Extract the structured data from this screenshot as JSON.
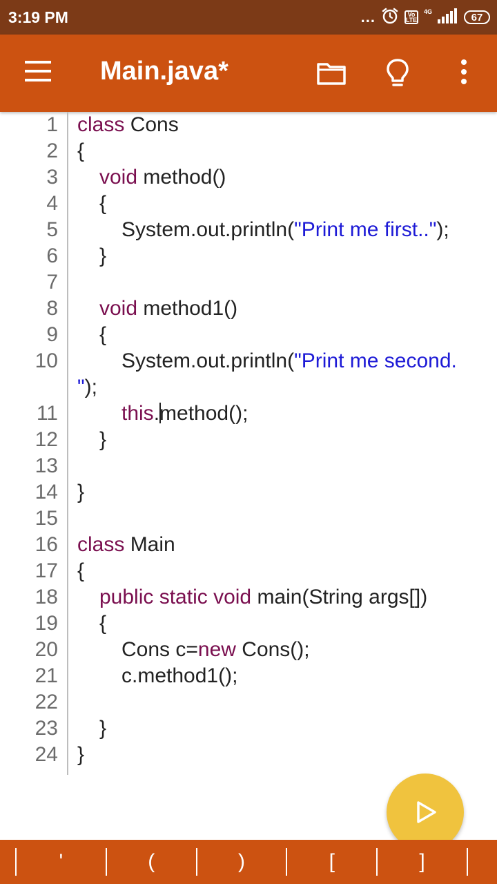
{
  "status_bar": {
    "time": "3:19 PM",
    "dots": "...",
    "lte": "Vo LTE",
    "network": "4G",
    "battery": "67"
  },
  "app_bar": {
    "title": "Main.java*"
  },
  "editor": {
    "line_numbers": [
      "1",
      "2",
      "3",
      "4",
      "5",
      "6",
      "7",
      "8",
      "9",
      "10",
      "11",
      "12",
      "13",
      "14",
      "15",
      "16",
      "17",
      "18",
      "19",
      "20",
      "21",
      "22",
      "23",
      "24"
    ],
    "lines": {
      "l1_kw": "class",
      "l1_rest": " Cons",
      "l2": "{",
      "l3_kw": "void",
      "l3_rest": " method()",
      "l4": "{",
      "l5_pre": "System.out.println(",
      "l5_str": "\"Print me first..\"",
      "l5_post": ");",
      "l6": "}",
      "l8_kw": "void",
      "l8_rest": " method1()",
      "l9": "{",
      "l10_pre": "System.out.println(",
      "l10_str": "\"Print me second.",
      "l10_wrap_str": "\"",
      "l10_wrap_post": ");",
      "l11_kw": "this",
      "l11_dot": ".",
      "l11_rest": "method();",
      "l12": "}",
      "l14": "}",
      "l16_kw": "class",
      "l16_rest": " Main",
      "l17": "{",
      "l18_kw": "public static void",
      "l18_rest": " main(String args[])",
      "l19": "{",
      "l20_pre": "Cons c=",
      "l20_kw": "new",
      "l20_post": " Cons();",
      "l21": "c.method1();",
      "l23": "}",
      "l24": "}"
    }
  },
  "symbol_bar": {
    "symbols": [
      "'",
      "(",
      ")",
      "[",
      "]"
    ]
  },
  "colors": {
    "status_bar": "#7c3a17",
    "app_bar": "#cc5211",
    "keyword": "#7a0f4f",
    "string": "#1d1ad6",
    "fab": "#f0c33e"
  },
  "icons": {
    "menu": "hamburger-icon",
    "folder": "folder-icon",
    "bulb": "lightbulb-icon",
    "more": "more-vert-icon",
    "run": "play-icon"
  }
}
